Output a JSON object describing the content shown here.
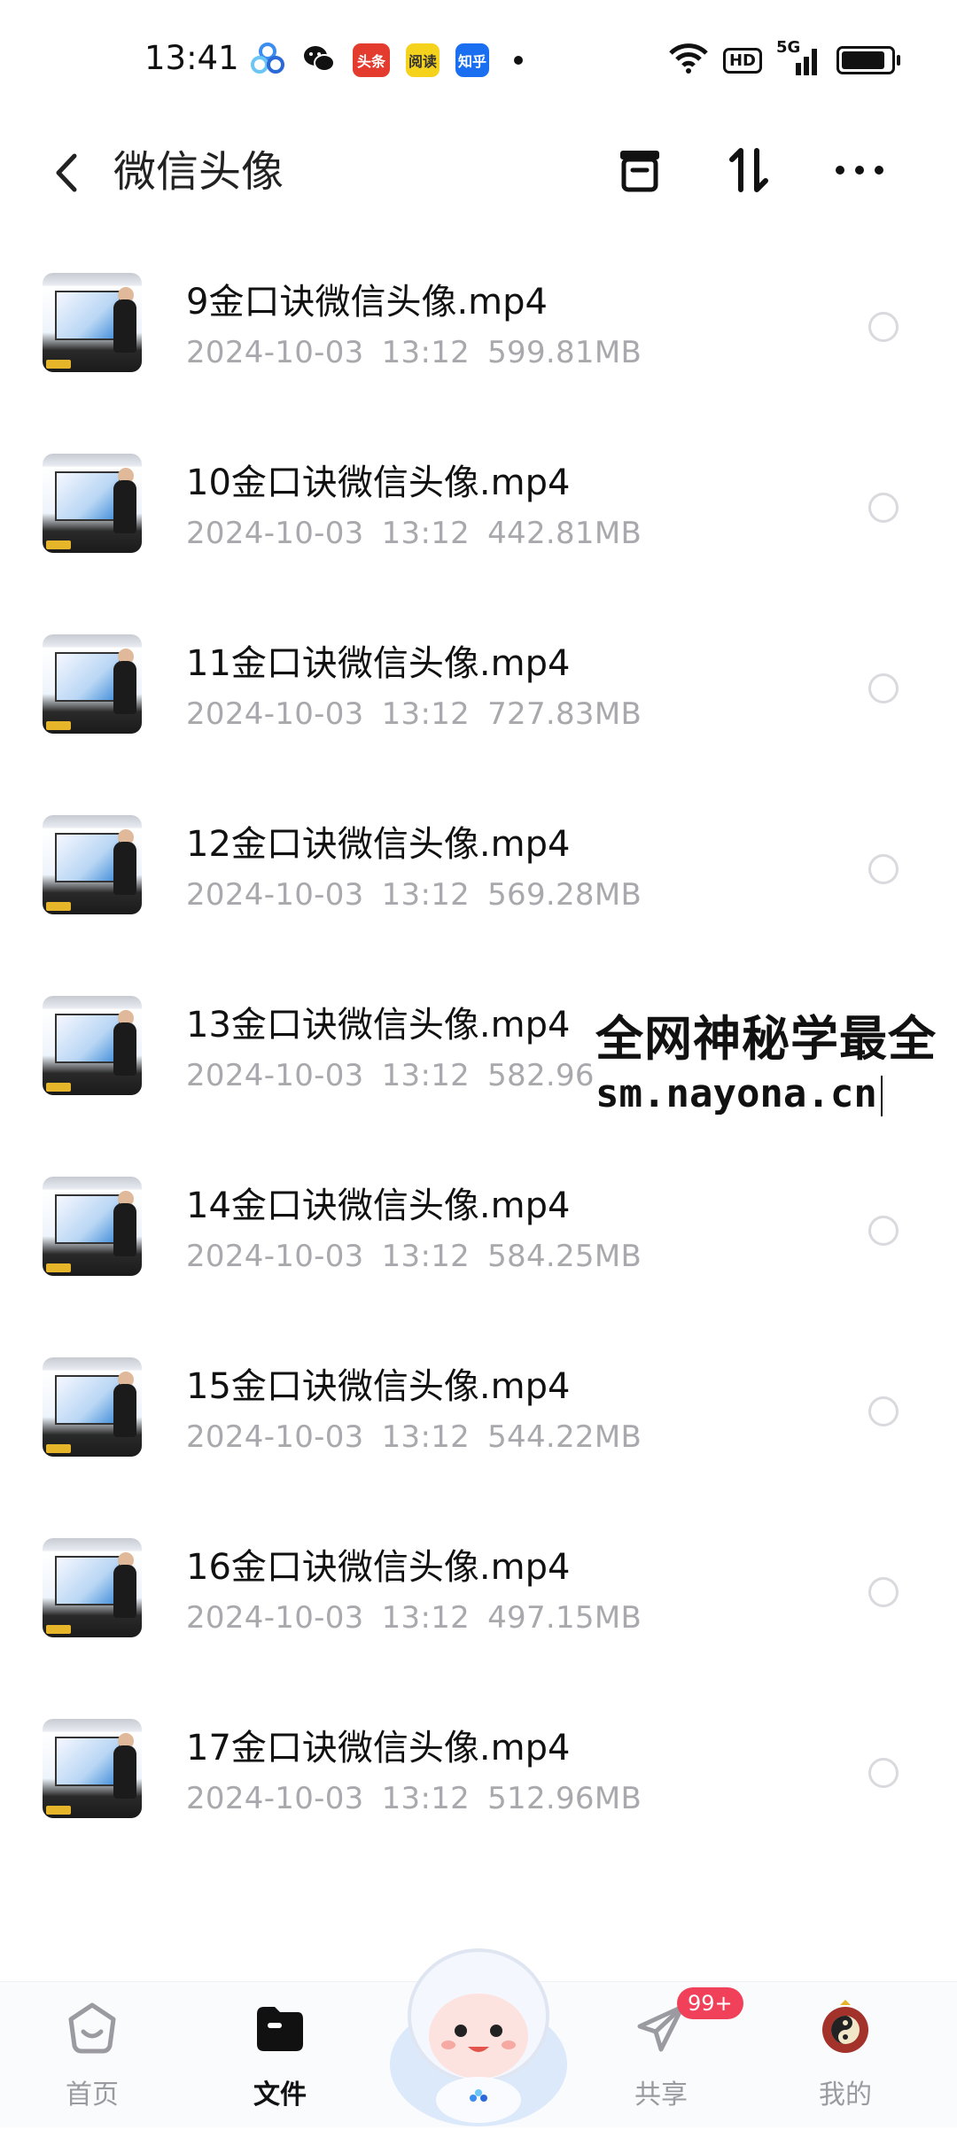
{
  "status_bar": {
    "time": "13:41",
    "app_icons": [
      "app-cloud-icon",
      "wechat-icon",
      "toutiao-icon",
      "news-icon",
      "zhihu-icon"
    ],
    "icon_labels": {
      "toutiao": "头条",
      "news": "阅读",
      "zhihu": "知乎"
    },
    "network_hd": "HD",
    "network_gen": "5G"
  },
  "header": {
    "title": "微信头像"
  },
  "files": [
    {
      "name": "9金口诀微信头像.mp4",
      "date": "2024-10-03",
      "time": "13:12",
      "size": "599.81MB"
    },
    {
      "name": "10金口诀微信头像.mp4",
      "date": "2024-10-03",
      "time": "13:12",
      "size": "442.81MB"
    },
    {
      "name": "11金口诀微信头像.mp4",
      "date": "2024-10-03",
      "time": "13:12",
      "size": "727.83MB"
    },
    {
      "name": "12金口诀微信头像.mp4",
      "date": "2024-10-03",
      "time": "13:12",
      "size": "569.28MB"
    },
    {
      "name": "13金口诀微信头像.mp4",
      "date": "2024-10-03",
      "time": "13:12",
      "size": "582.96MB"
    },
    {
      "name": "14金口诀微信头像.mp4",
      "date": "2024-10-03",
      "time": "13:12",
      "size": "584.25MB"
    },
    {
      "name": "15金口诀微信头像.mp4",
      "date": "2024-10-03",
      "time": "13:12",
      "size": "544.22MB"
    },
    {
      "name": "16金口诀微信头像.mp4",
      "date": "2024-10-03",
      "time": "13:12",
      "size": "497.15MB"
    },
    {
      "name": "17金口诀微信头像.mp4",
      "date": "2024-10-03",
      "time": "13:12",
      "size": "512.96MB"
    }
  ],
  "watermark": {
    "line1": "全网神秘学最全",
    "line2": "sm.nayona.cn"
  },
  "nav": {
    "home": "首页",
    "files": "文件",
    "share": "共享",
    "share_badge": "99+",
    "mine": "我的"
  },
  "colors": {
    "accent": "#111111",
    "meta_gray": "#a8a8ad",
    "badge": "#f0405a"
  }
}
